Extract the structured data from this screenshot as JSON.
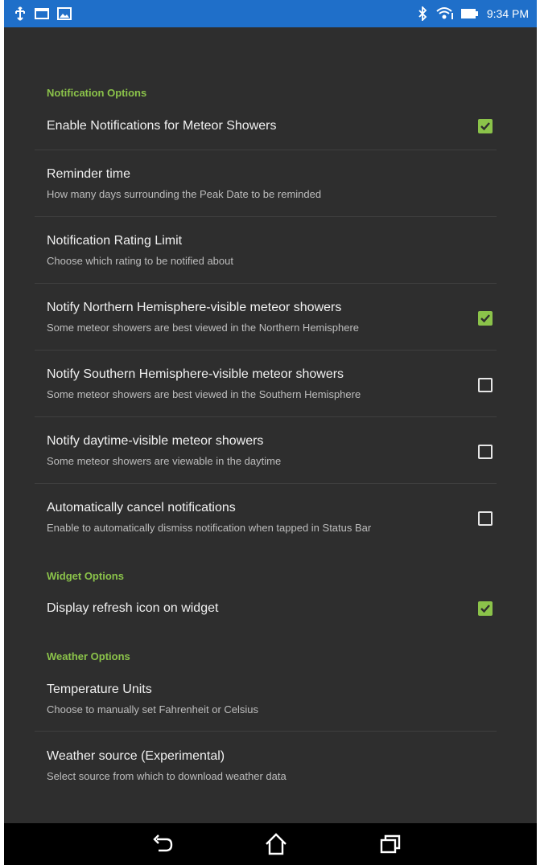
{
  "status_bar": {
    "left_icons": [
      "usb-icon",
      "screen-icon",
      "gallery-icon"
    ],
    "right_icons": [
      "bluetooth-icon",
      "wifi-icon",
      "battery-icon"
    ],
    "time": "9:34 PM",
    "color": "#1f6fc9"
  },
  "accent_color": "#8bc34a",
  "sections": {
    "notification": {
      "header": "Notification Options",
      "enable": {
        "title": "Enable Notifications for Meteor Showers",
        "checked": true
      },
      "reminder": {
        "title": "Reminder time",
        "summary": "How many days surrounding the Peak Date to be reminded"
      },
      "rating": {
        "title": "Notification Rating Limit",
        "summary": "Choose which rating to be notified about"
      },
      "northern": {
        "title": "Notify Northern Hemisphere-visible meteor showers",
        "summary": "Some meteor showers are best viewed in the Northern Hemisphere",
        "checked": true
      },
      "southern": {
        "title": "Notify Southern Hemisphere-visible meteor showers",
        "summary": "Some meteor showers are best viewed in the Southern Hemisphere",
        "checked": false
      },
      "daytime": {
        "title": "Notify daytime-visible meteor showers",
        "summary": "Some meteor showers are viewable in the daytime",
        "checked": false
      },
      "autocancel": {
        "title": "Automatically cancel notifications",
        "summary": "Enable to automatically dismiss notification when tapped in Status Bar",
        "checked": false
      }
    },
    "widget": {
      "header": "Widget Options",
      "refresh": {
        "title": "Display refresh icon on widget",
        "checked": true
      }
    },
    "weather": {
      "header": "Weather Options",
      "units": {
        "title": "Temperature Units",
        "summary": "Choose to manually set Fahrenheit or Celsius"
      },
      "source": {
        "title": "Weather source (Experimental)",
        "summary": "Select source from which to download weather data"
      }
    }
  },
  "nav_bar": {
    "buttons": [
      "back-icon",
      "home-icon",
      "recents-icon"
    ]
  }
}
